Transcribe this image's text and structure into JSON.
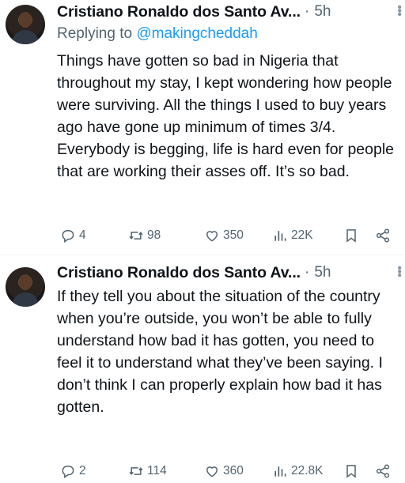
{
  "tweets": [
    {
      "author": "Cristiano Ronaldo dos Santo Av...",
      "separator": "·",
      "time": "5h",
      "replying_prefix": "Replying to",
      "replying_handle": "@makingcheddah",
      "text": "Things have gotten so bad in Nigeria that throughout my stay, I kept wondering how people were surviving. All the things I used to buy years ago have gone up minimum of times 3/4. Everybody is begging, life is hard even for people that are working their asses off. It’s so bad.",
      "replies": "4",
      "retweets": "98",
      "likes": "350",
      "views": "22K"
    },
    {
      "author": "Cristiano Ronaldo dos Santo Av...",
      "separator": "·",
      "time": "5h",
      "text": "If they tell you about the situation of the country when you’re outside, you won’t be able to fully understand how bad it has gotten, you need to feel it to understand what they’ve been saying. I don’t think I can properly explain how bad it has gotten.",
      "replies": "2",
      "retweets": "114",
      "likes": "360",
      "views": "22.8K"
    }
  ],
  "icons": {
    "reply": "reply-icon",
    "retweet": "retweet-icon",
    "like": "heart-icon",
    "views": "views-icon",
    "bookmark": "bookmark-icon",
    "share": "share-icon",
    "more": "more-icon"
  },
  "colors": {
    "link": "#1d9bf0",
    "secondary": "#536471",
    "text": "#0f1419"
  }
}
